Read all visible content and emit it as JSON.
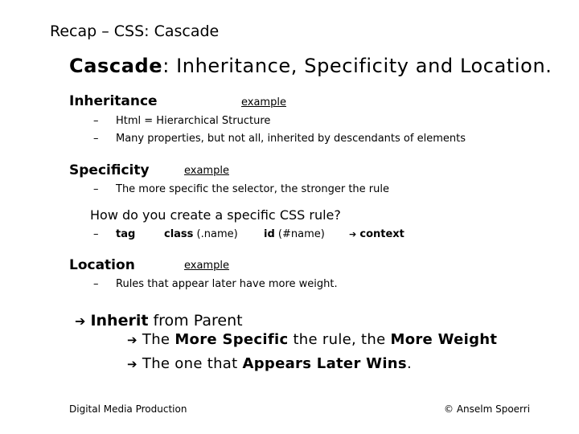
{
  "slide": {
    "title": "Recap – CSS: Cascade",
    "heading": {
      "bold": "Cascade",
      "rest": ": Inheritance, Specificity and Location."
    },
    "sections": {
      "inheritance": {
        "title": "Inheritance",
        "link": "example",
        "bullets": [
          "Html = Hierarchical Structure",
          "Many properties, but not all, inherited by descendants of elements"
        ]
      },
      "specificity": {
        "title": "Specificity",
        "link": "example",
        "bullets": [
          "The more specific the selector, the stronger the rule"
        ],
        "question": "How do you create a specific CSS rule?",
        "selectors": {
          "tag": "tag",
          "class_bold": "class",
          "class_rest": " (.name)",
          "id_bold": "id",
          "id_rest": " (#name)",
          "context": "context"
        }
      },
      "location": {
        "title": "Location",
        "link": "example",
        "bullets": [
          "Rules that appear later have more weight."
        ]
      }
    },
    "summary": {
      "line1_bold": "Inherit",
      "line1_rest": " from Parent",
      "line2_a": "The ",
      "line2_b": "More Specific",
      "line2_c": " the rule, the ",
      "line2_d": "More Weight",
      "line3_a": "The one that ",
      "line3_b": "Appears Later Wins",
      "line3_c": "."
    },
    "bullet_dash": "–",
    "arrow": "➔",
    "footer": {
      "left": "Digital Media Production",
      "right": "© Anselm Spoerri"
    }
  }
}
